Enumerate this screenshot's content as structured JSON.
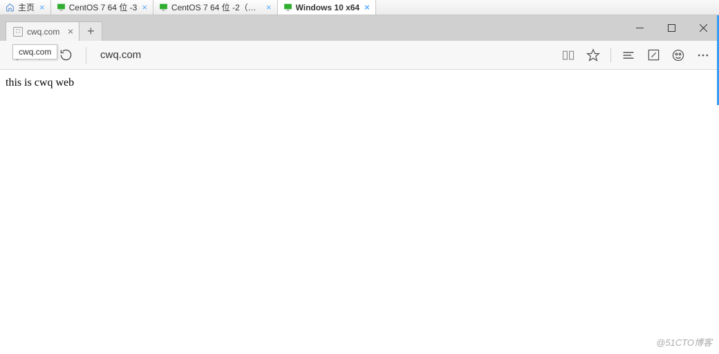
{
  "vm_tabs": [
    {
      "label": "主页",
      "type": "home"
    },
    {
      "label": "CentOS 7 64 位 -3",
      "type": "vm"
    },
    {
      "label": "CentOS 7 64 位 -2（架构专...",
      "type": "vm"
    },
    {
      "label": "Windows 10 x64",
      "type": "vm",
      "active": true
    }
  ],
  "browser": {
    "tab_title": "cwq.com",
    "tab_tooltip": "cwq.com",
    "address_url": "cwq.com"
  },
  "page": {
    "body_text": "this is cwq web"
  },
  "watermark": "@51CTO博客"
}
